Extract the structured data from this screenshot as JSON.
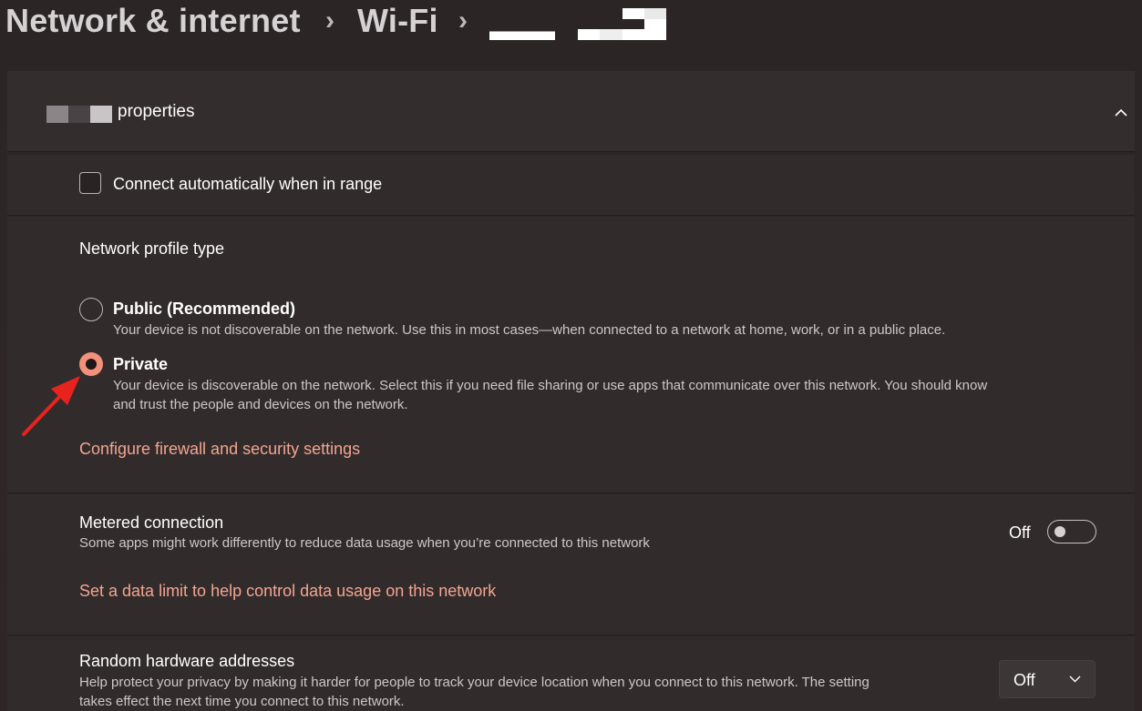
{
  "breadcrumb": {
    "items": [
      "Network & internet",
      "Wi-Fi"
    ],
    "separator": "›"
  },
  "properties": {
    "title_suffix": "properties"
  },
  "auto_connect": {
    "label": "Connect automatically when in range",
    "checked": false
  },
  "profile": {
    "heading": "Network profile type",
    "options": [
      {
        "label": "Public (Recommended)",
        "description": "Your device is not discoverable on the network. Use this in most cases—when connected to a network at home, work, or in a public place.",
        "selected": false
      },
      {
        "label": "Private",
        "description_line1": "Your device is discoverable on the network. Select this if you need file sharing or use apps that communicate over this network. You should know",
        "description_line2": "and trust the people and devices on the network.",
        "selected": true
      }
    ],
    "firewall_link": "Configure firewall and security settings"
  },
  "metered": {
    "label": "Metered connection",
    "description": "Some apps might work differently to reduce data usage when you’re connected to this network",
    "state_label": "Off",
    "on": false,
    "data_limit_link": "Set a data limit to help control data usage on this network"
  },
  "random_hw": {
    "label": "Random hardware addresses",
    "description_line1": "Help protect your privacy by making it harder for people to track your device location when you connect to this network. The setting",
    "description_line2": "takes effect the next time you connect to this network.",
    "selected_value": "Off"
  },
  "icons": {
    "breadcrumb_separator": "chevron-right-icon",
    "collapse": "chevron-up-icon",
    "dropdown": "chevron-down-icon",
    "annotation": "red-arrow-annotation"
  },
  "colors": {
    "accent": "#f3907a",
    "link": "#f3a58f",
    "annotation_arrow": "#e8231e"
  }
}
